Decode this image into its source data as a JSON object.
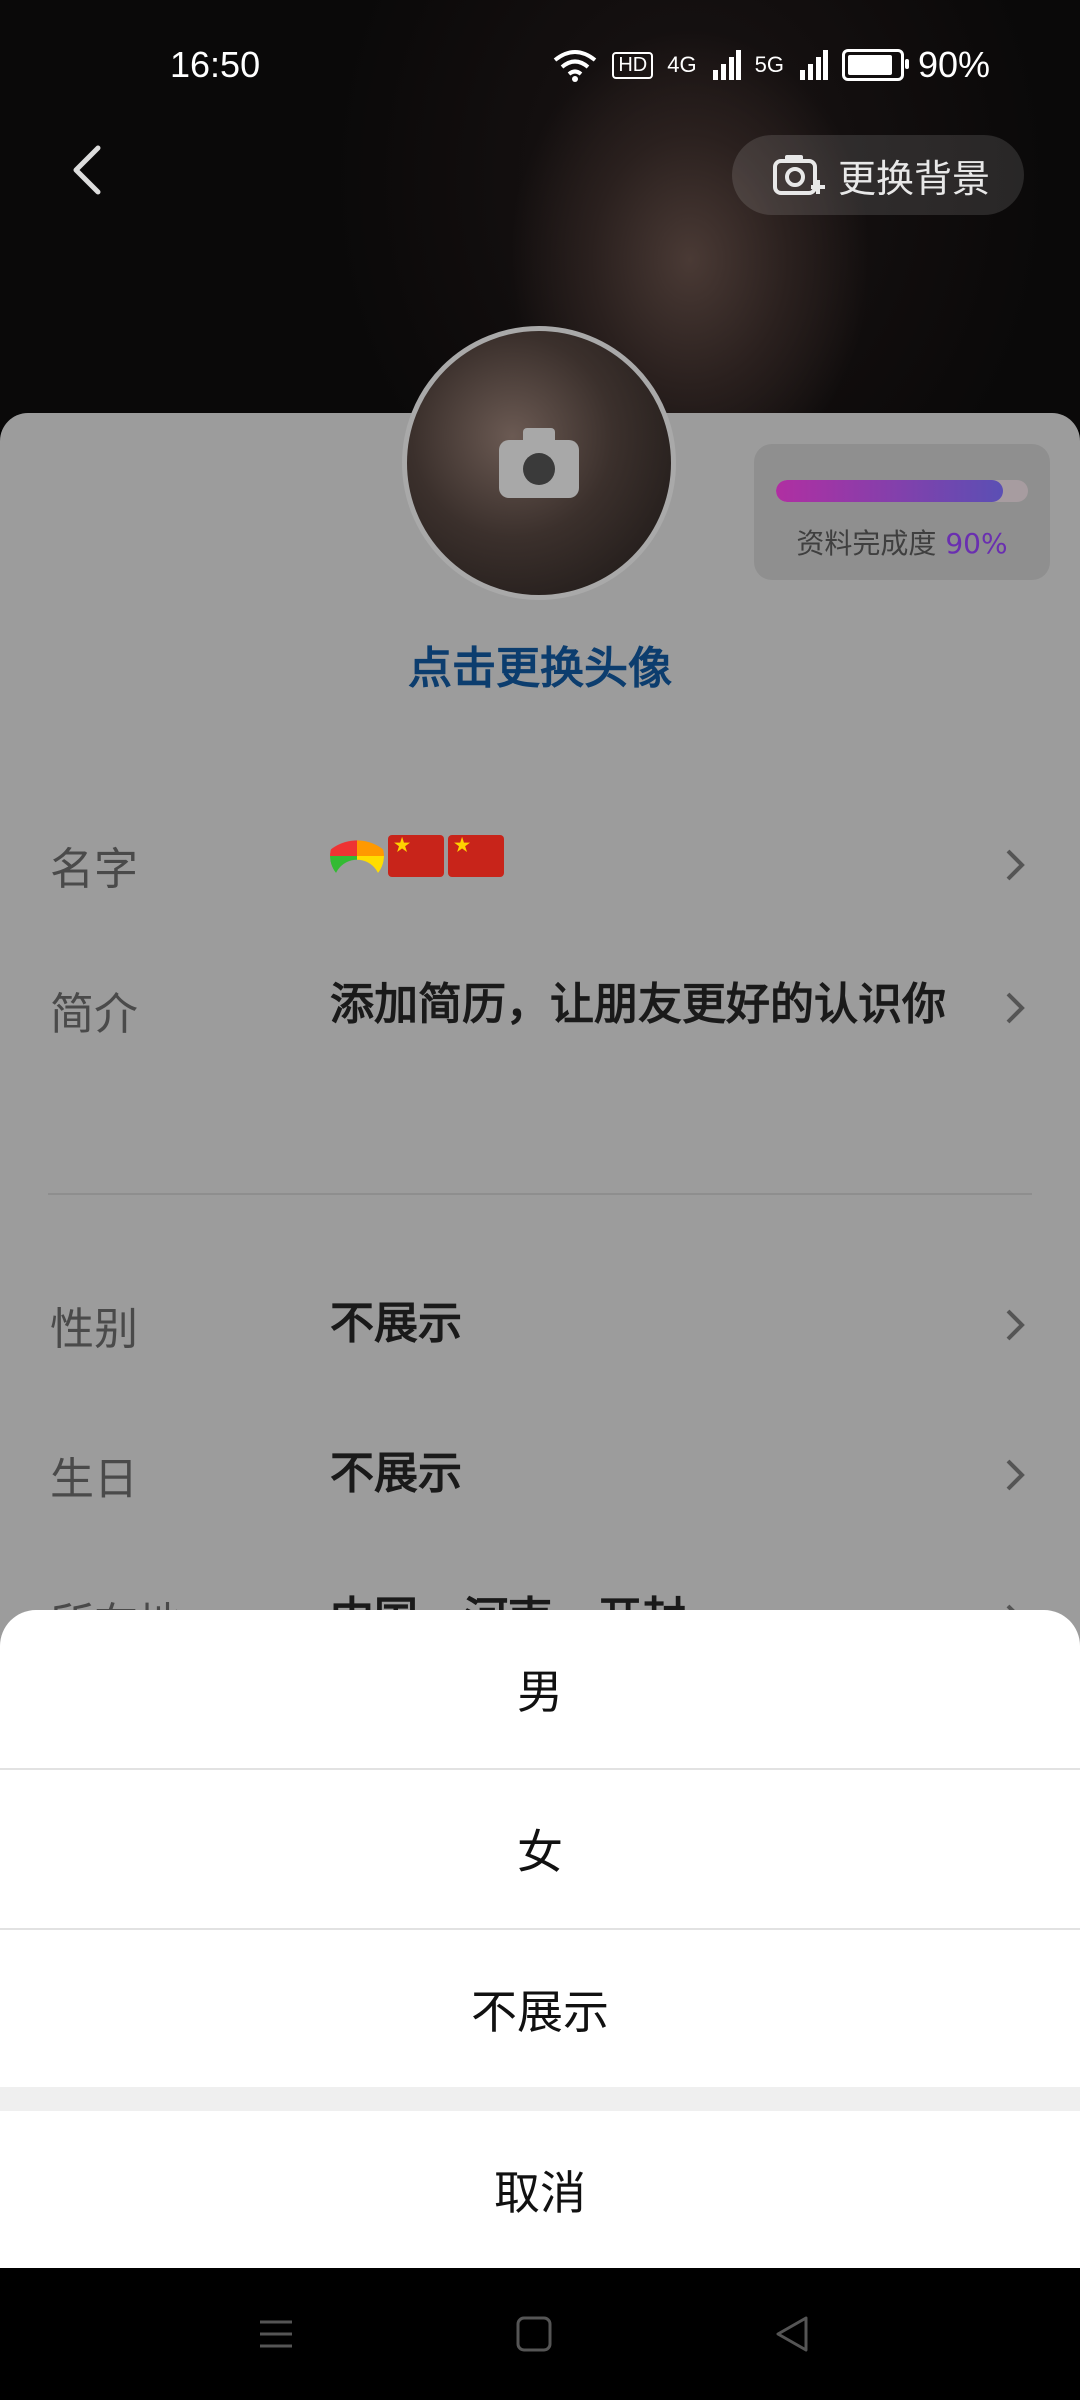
{
  "status": {
    "time": "16:50",
    "battery": "90%",
    "hd": "HD",
    "net1": "4G",
    "net2": "5G",
    "battery_fraction": 0.9
  },
  "header": {
    "change_background_label": "更换背景"
  },
  "avatar": {
    "caption": "点击更换头像"
  },
  "completion": {
    "label": "资料完成度",
    "percent_text": "90%",
    "progress": 0.9
  },
  "profile": {
    "name_label": "名字",
    "bio_label": "简介",
    "bio_value": "添加简历，让朋友更好的认识你",
    "gender_label": "性别",
    "gender_value": "不展示",
    "birthday_label": "生日",
    "birthday_value": "不展示",
    "location_label": "所在地",
    "location_value": "中国 · 河南 · 开封"
  },
  "action_sheet": {
    "options": [
      "男",
      "女",
      "不展示"
    ],
    "cancel": "取消"
  }
}
